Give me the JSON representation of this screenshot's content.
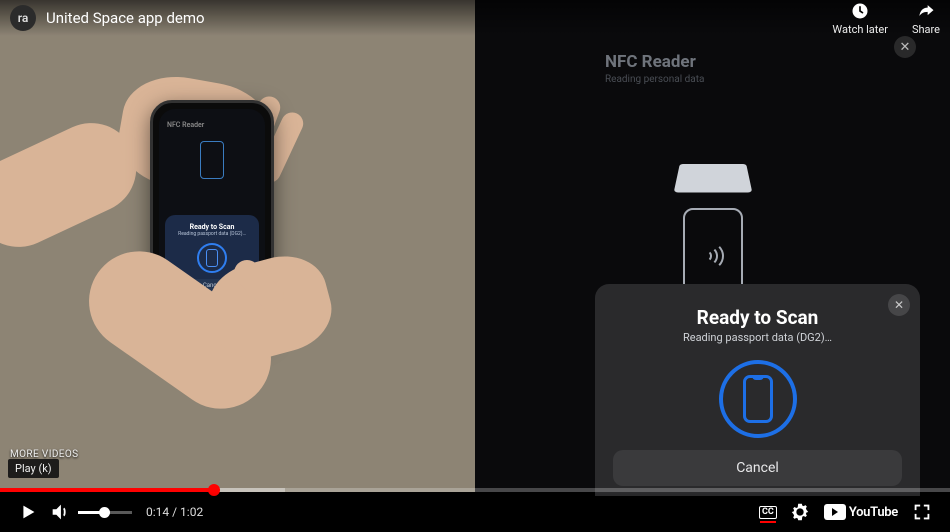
{
  "header": {
    "avatar_text": "ra",
    "title": "United Space app demo",
    "watch_later": "Watch later",
    "share": "Share"
  },
  "overlay": {
    "more_videos": "MORE VIDEOS",
    "play_tooltip": "Play (k)"
  },
  "left_phone": {
    "nfc_title": "NFC Reader",
    "sheet_title": "Ready to Scan",
    "sheet_sub": "Reading passport data (DG2)…",
    "cancel": "Cancel"
  },
  "right_pane": {
    "nfc_title": "NFC Reader",
    "nfc_sub": "Reading personal data",
    "sheet_title": "Ready to Scan",
    "sheet_sub": "Reading passport data (DG2)…",
    "cancel": "Cancel"
  },
  "controls": {
    "current_time": "0:14",
    "duration": "1:02",
    "time_sep": " / ",
    "cc": "CC",
    "youtube": "YouTube"
  },
  "progress": {
    "played_pct": 22.5,
    "loaded_pct": 30
  }
}
